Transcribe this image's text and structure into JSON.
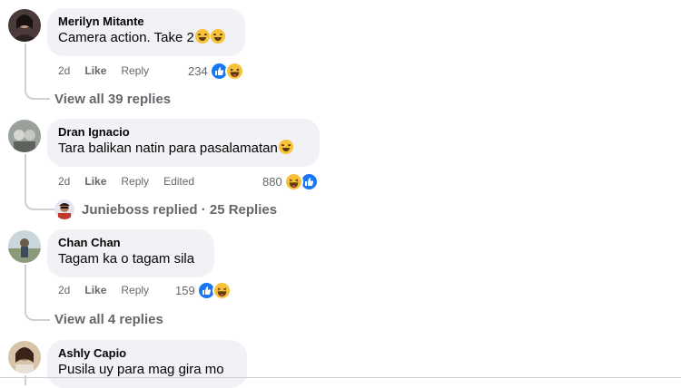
{
  "comments": [
    {
      "author": "Merilyn Mitante",
      "text": "Camera action. Take 2",
      "time": "2d",
      "like": "Like",
      "reply": "Reply",
      "edited": "",
      "reaction_count": "234",
      "reactions": [
        "like-icon",
        "haha-icon"
      ],
      "replies_text": "View all 39 replies"
    },
    {
      "author": "Dran Ignacio",
      "text": "Tara balikan natin para pasalamatan",
      "time": "2d",
      "like": "Like",
      "reply": "Reply",
      "edited": "Edited",
      "reaction_count": "880",
      "reactions": [
        "haha-icon",
        "like-icon"
      ],
      "replies_text": "Junieboss replied · 25 Replies"
    },
    {
      "author": "Chan Chan",
      "text": "Tagam ka o tagam sila",
      "time": "2d",
      "like": "Like",
      "reply": "Reply",
      "edited": "",
      "reaction_count": "159",
      "reactions": [
        "like-icon",
        "haha-icon"
      ],
      "replies_text": "View all 4 replies"
    },
    {
      "author": "Ashly Capio",
      "text": "Pusila uy para mag gira mo"
    }
  ],
  "colors": {
    "bubble": "#f0f2f5",
    "meta": "#65676b",
    "like_blue": "#1877f2",
    "haha_yellow": "#f7c13a",
    "thread_line": "#ced0d4"
  }
}
